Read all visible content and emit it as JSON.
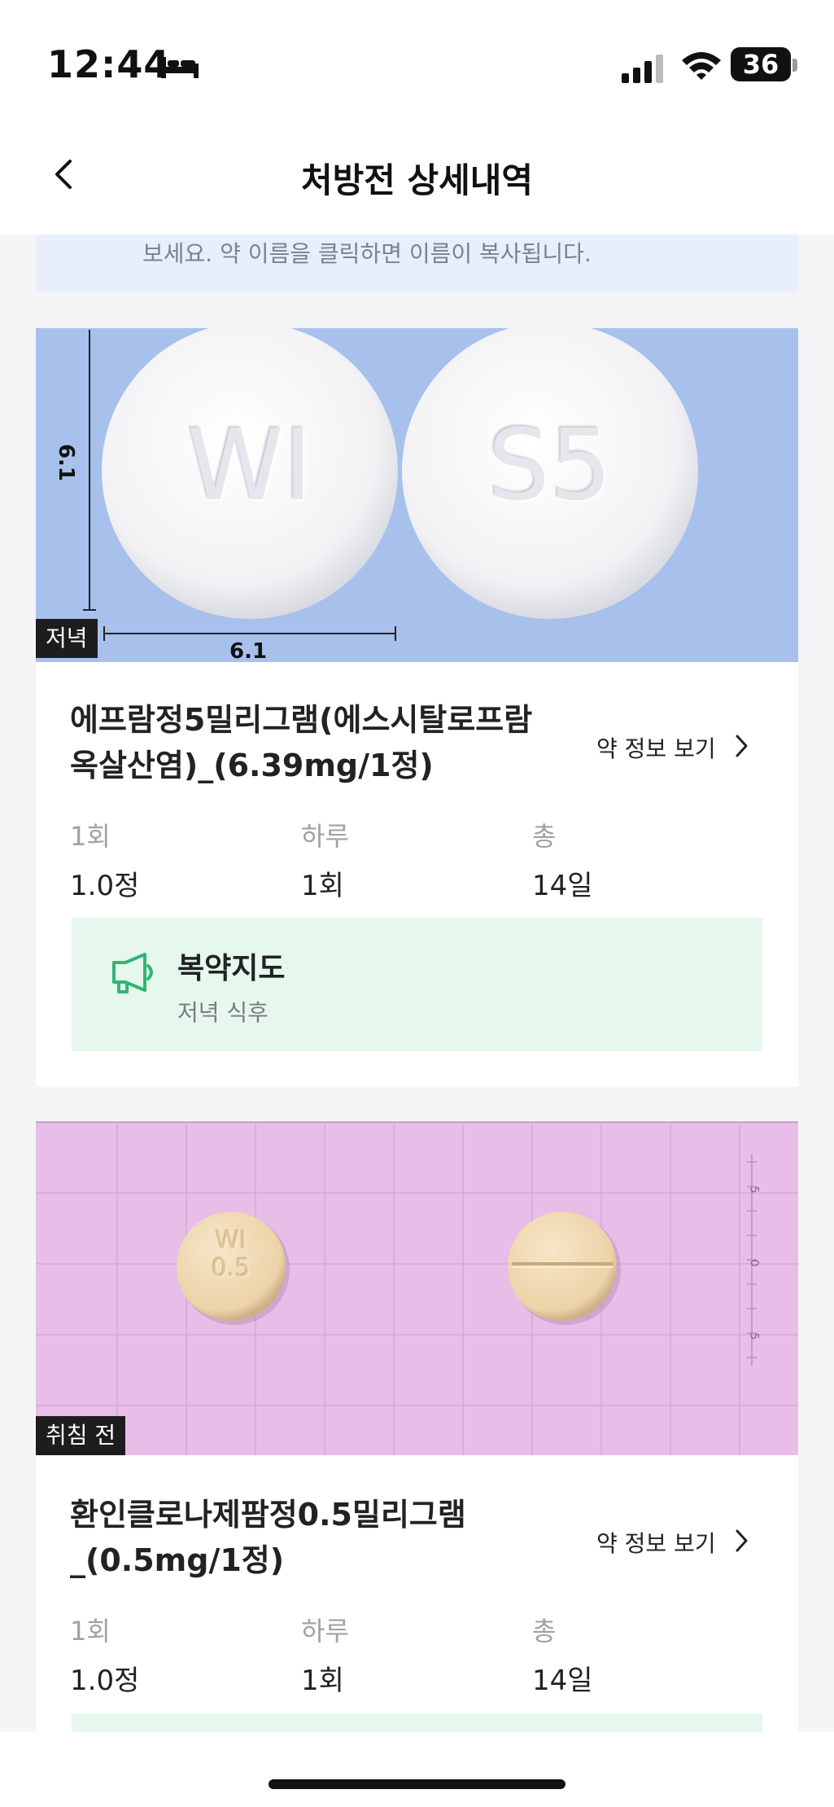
{
  "status_bar": {
    "time": "12:44",
    "battery": "36"
  },
  "header": {
    "title": "처방전 상세내역"
  },
  "notice": {
    "text": "보세요. 약 이름을 클릭하면 이름이 복사됩니다."
  },
  "drugs": [
    {
      "image": {
        "tag": "저녁",
        "imprint_front": "WI",
        "imprint_back": "S5",
        "dimension_h": "6.1",
        "dimension_w": "6.1",
        "background": "#a8c0ec"
      },
      "name": "에프람정5밀리그램(에스시탈로프람옥살산염)_(6.39mg/1정)",
      "name_line1": "에프람정5밀리그램(에스시탈로프람",
      "name_line2": "옥살산염)_(6.39mg/1정)",
      "info_link": "약 정보 보기",
      "columns": [
        {
          "label": "1회",
          "value": "1.0정"
        },
        {
          "label": "하루",
          "value": "1회"
        },
        {
          "label": "총",
          "value": "14일"
        }
      ],
      "guide": {
        "title": "복약지도",
        "detail": "저녁 식후"
      }
    },
    {
      "image": {
        "tag": "취침 전",
        "imprint_front_line1": "WI",
        "imprint_front_line2": "0.5",
        "ruler_marks": [
          "5",
          "0",
          "5"
        ],
        "background": "#e8bde8"
      },
      "name": "환인클로나제팜정0.5밀리그램_(0.5mg/1정)",
      "name_line1": "환인클로나제팜정0.5밀리그램",
      "name_line2": "_(0.5mg/1정)",
      "info_link": "약 정보 보기",
      "columns": [
        {
          "label": "1회",
          "value": "1.0정"
        },
        {
          "label": "하루",
          "value": "1회"
        },
        {
          "label": "총",
          "value": "14일"
        }
      ]
    }
  ],
  "colors": {
    "accent_green": "#2fb673",
    "guide_bg": "#e6f7ee"
  }
}
